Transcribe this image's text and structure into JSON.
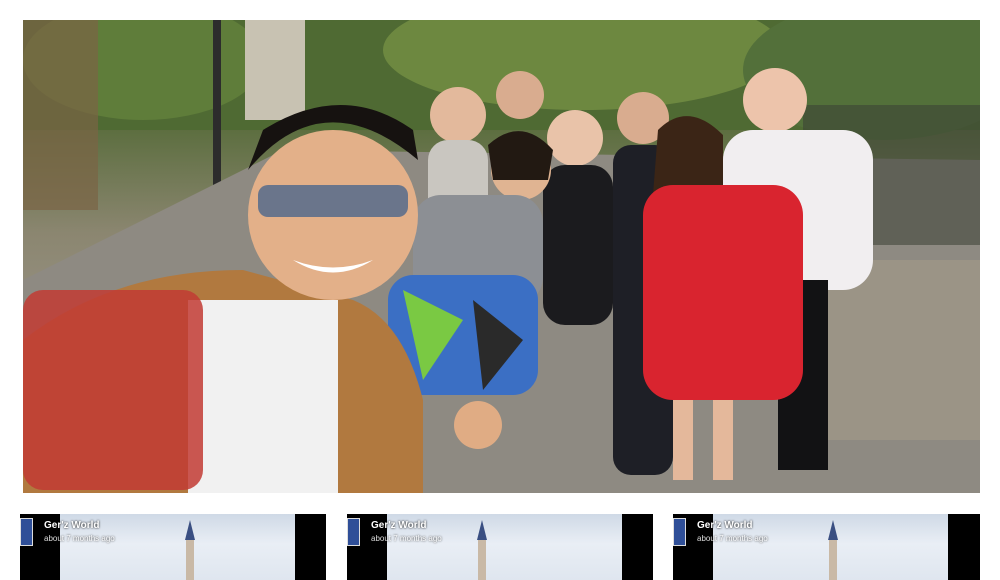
{
  "photo": {
    "subject": "group-selfie"
  },
  "posts": [
    {
      "poster": "Ger'z World",
      "time": "about 7 months ago"
    },
    {
      "poster": "Ger'z World",
      "time": "about 7 months ago"
    },
    {
      "poster": "Ger'z World",
      "time": "about 7 months ago"
    }
  ],
  "colors": {
    "background": "#ffffff",
    "thumb_bg": "#000000"
  },
  "icons": [
    "castle-icon",
    "avatar-icon"
  ]
}
